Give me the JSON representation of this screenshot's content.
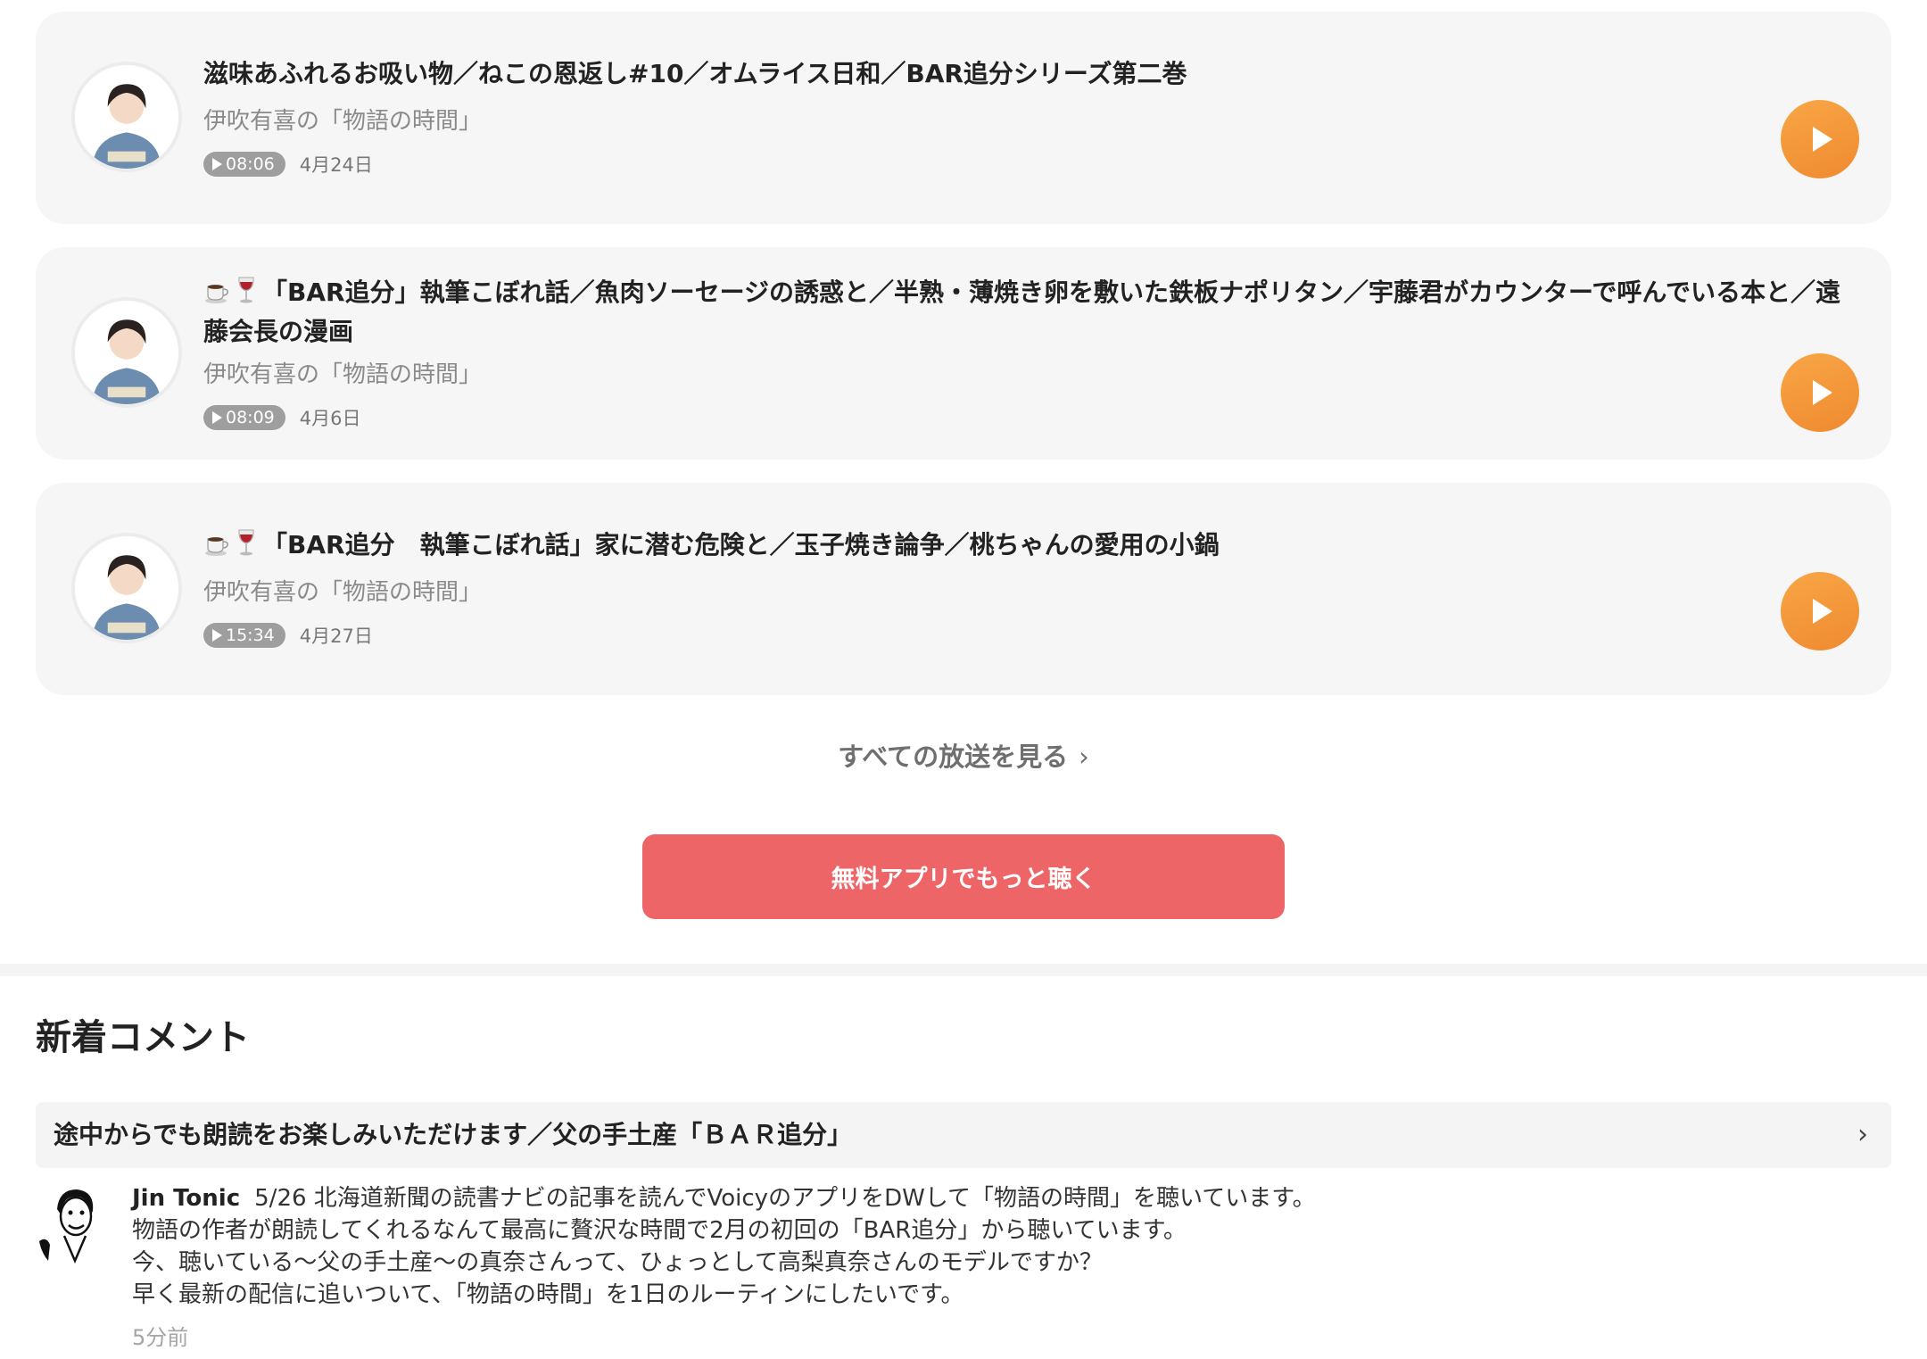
{
  "episodes": [
    {
      "title": "滋味あふれるお吸い物／ねこの恩返し#10／オムライス日和／BAR追分シリーズ第二巻",
      "has_emoji": false,
      "channel": "伊吹有喜の「物語の時間」",
      "duration": "08:06",
      "date": "4月24日"
    },
    {
      "title": "「BAR追分」執筆こぼれ話／魚肉ソーセージの誘惑と／半熟・薄焼き卵を敷いた鉄板ナポリタン／宇藤君がカウンターで呼んでいる本と／遠藤会長の漫画",
      "has_emoji": true,
      "channel": "伊吹有喜の「物語の時間」",
      "duration": "08:09",
      "date": "4月6日"
    },
    {
      "title": "「BAR追分　執筆こぼれ話」家に潜む危険と／玉子焼き論争／桃ちゃんの愛用の小鍋",
      "has_emoji": true,
      "channel": "伊吹有喜の「物語の時間」",
      "duration": "15:34",
      "date": "4月27日"
    }
  ],
  "see_all_label": "すべての放送を見る",
  "cta_label": "無料アプリでもっと聴く",
  "comments_section": {
    "title": "新着コメント",
    "episode_title": "途中からでも朗読をお楽しみいただけます／父の手土産「ＢＡＲ追分」",
    "comment": {
      "author": "Jin Tonic",
      "lines": [
        "5/26 北海道新聞の読書ナビの記事を読んでVoicyのアプリをDWして「物語の時間」を聴いています。",
        "物語の作者が朗読してくれるなんて最高に贅沢な時間で2月の初回の「BAR追分」から聴いています。",
        "今、聴いている〜父の手土産〜の真奈さんって、ひょっとして高梨真奈さんのモデルですか？",
        "早く最新の配信に追いついて、「物語の時間」を1日のルーティンにしたいです。"
      ],
      "time": "5分前"
    }
  },
  "colors": {
    "play_button": "#f29a3a",
    "cta": "#ee6567",
    "card_bg": "#f6f6f6"
  },
  "icons": {
    "play": "play-icon",
    "coffee": "coffee-emoji-icon",
    "wine": "wine-emoji-icon",
    "chevron": "chevron-right-icon"
  }
}
